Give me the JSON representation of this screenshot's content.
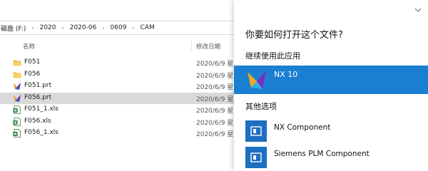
{
  "explorer": {
    "breadcrumb": [
      "磁盘 (F:)",
      "2020",
      "2020-06",
      "0609",
      "CAM"
    ],
    "columns": {
      "name": "名称",
      "date": "修改日期"
    },
    "files": [
      {
        "name": "F051",
        "date": "2020/6/9 星",
        "icon": "folder-icon"
      },
      {
        "name": "F056",
        "date": "2020/6/9 星",
        "icon": "folder-icon"
      },
      {
        "name": "F051.prt",
        "date": "2020/6/9 星",
        "icon": "nx-part-icon"
      },
      {
        "name": "F056.prt",
        "date": "2020/6/9 星",
        "icon": "nx-part-icon",
        "selected": true
      },
      {
        "name": "F051_1.xls",
        "date": "2020/6/9 星",
        "icon": "excel-file-icon"
      },
      {
        "name": "F056.xls",
        "date": "2020/6/9 星",
        "icon": "excel-file-icon"
      },
      {
        "name": "F056_1.xls",
        "date": "2020/6/9 星",
        "icon": "excel-file-icon"
      }
    ]
  },
  "open_with": {
    "title": "你要如何打开这个文件?",
    "continue_label": "继续使用此应用",
    "current_app": {
      "name": "NX 10",
      "icon": "nx-app-icon"
    },
    "other_label": "其他选项",
    "other_apps": [
      {
        "name": "NX Component",
        "icon": "component-app-icon"
      },
      {
        "name": "Siemens PLM Component",
        "icon": "component-app-icon"
      }
    ],
    "colors": {
      "accent": "#1a7fd1",
      "selected_row": "#d9d9d9"
    }
  }
}
